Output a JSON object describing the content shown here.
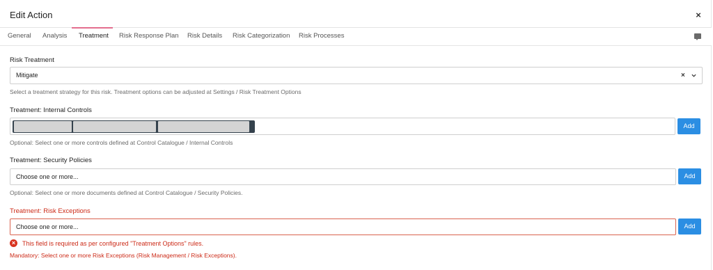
{
  "modal": {
    "title": "Edit Action",
    "close_label": "×"
  },
  "tabs": [
    {
      "label": "General"
    },
    {
      "label": "Analysis"
    },
    {
      "label": "Treatment"
    },
    {
      "label": "Risk Response Plan"
    },
    {
      "label": "Risk Details"
    },
    {
      "label": "Risk Categorization"
    },
    {
      "label": "Risk Processes"
    }
  ],
  "active_tab": "Treatment",
  "risk_treatment": {
    "label": "Risk Treatment",
    "value": "Mitigate",
    "clear_label": "×",
    "help": "Select a treatment strategy for this risk. Treatment options can be adjusted at Settings / Risk Treatment Options"
  },
  "internal_controls": {
    "label": "Treatment: Internal Controls",
    "add_label": "Add",
    "help": "Optional: Select one or more controls defined at Control Catalogue / Internal Controls"
  },
  "security_policies": {
    "label": "Treatment: Security Policies",
    "placeholder": "Choose one or more...",
    "add_label": "Add",
    "help": "Optional: Select one or more documents defined at Control Catalogue / Security Policies."
  },
  "risk_exceptions": {
    "label": "Treatment: Risk Exceptions",
    "placeholder": "Choose one or more...",
    "add_label": "Add",
    "error_message": "This field is required as per configured \"Treatment Options\" rules.",
    "help": "Mandatory: Select one or more Risk Exceptions (Risk Management / Risk Exceptions)."
  },
  "colors": {
    "primary": "#2b8ee3",
    "error": "#cc2a17",
    "tab_indicator": "#e46e8e"
  }
}
